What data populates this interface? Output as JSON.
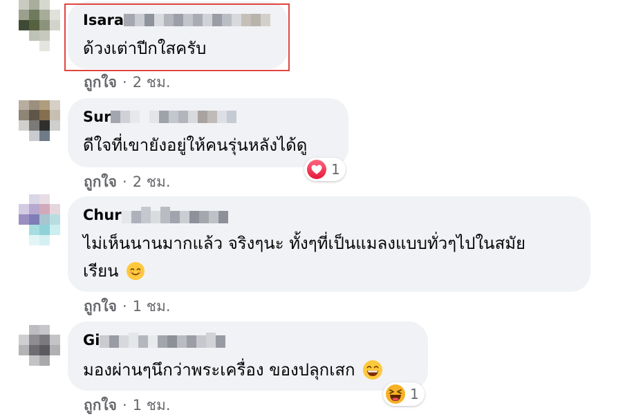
{
  "comments": [
    {
      "name": "Isara",
      "text": "ด้วงเต่าปีกใสครับ",
      "like_label": "ถูกใจ",
      "separator": "·",
      "time": "2 ชม."
    },
    {
      "name": "Sur",
      "text": "ดีใจที่เขายังอยู่ให้คนรุ่นหลังได้ดู",
      "like_label": "ถูกใจ",
      "separator": "·",
      "time": "2 ชม.",
      "reaction": {
        "icon": "love-reaction-icon",
        "count": "1",
        "color": "#f33e58"
      }
    },
    {
      "name": "Chur",
      "text_line1": "ไม่เห็นนานมากแล้ว จริงๆนะ ทั้งๆที่เป็นแมลงแบบทั่วๆไปในสมัย",
      "text_line2": "เรียน",
      "emoji": "smiling-face-icon",
      "like_label": "ถูกใจ",
      "separator": "·",
      "time": "1 ชม."
    },
    {
      "name": "Gi",
      "text": "มองผ่านๆนึกว่าพระเครื่อง ของปลุกเสก",
      "emoji": "grinning-face-icon",
      "like_label": "ถูกใจ",
      "separator": "·",
      "time": "1 ชม.",
      "reaction": {
        "icon": "haha-reaction-icon",
        "count": "1",
        "color": "#f7b125"
      }
    }
  ],
  "colors": {
    "bubble": "#f0f2f5",
    "meta_text": "#65676b",
    "highlight_border": "#e0443e"
  }
}
